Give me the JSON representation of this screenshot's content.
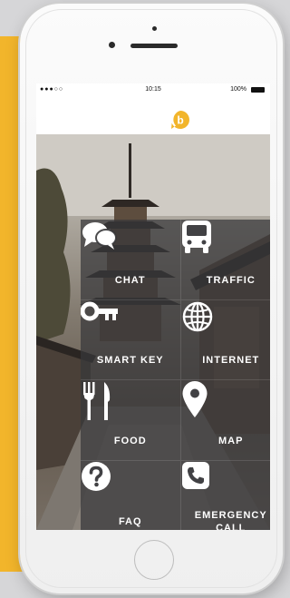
{
  "status_bar": {
    "carrier": "●●●○○",
    "time": "10:15",
    "battery_percent": "100%"
  },
  "app": {
    "logo_letter": "b",
    "brand_color": "#f2b52b"
  },
  "menu": {
    "chat": "CHAT",
    "traffic": "TRAFFIC",
    "smart_key": "SMART KEY",
    "internet": "INTERNET",
    "food": "FOOD",
    "map": "MAP",
    "faq": "FAQ",
    "emergency_line1": "EMERGENCY",
    "emergency_line2": "CALL"
  },
  "icons": [
    "chat-icon",
    "bus-icon",
    "key-icon",
    "globe-icon",
    "fork-knife-icon",
    "map-pin-icon",
    "question-icon",
    "phone-icon"
  ]
}
